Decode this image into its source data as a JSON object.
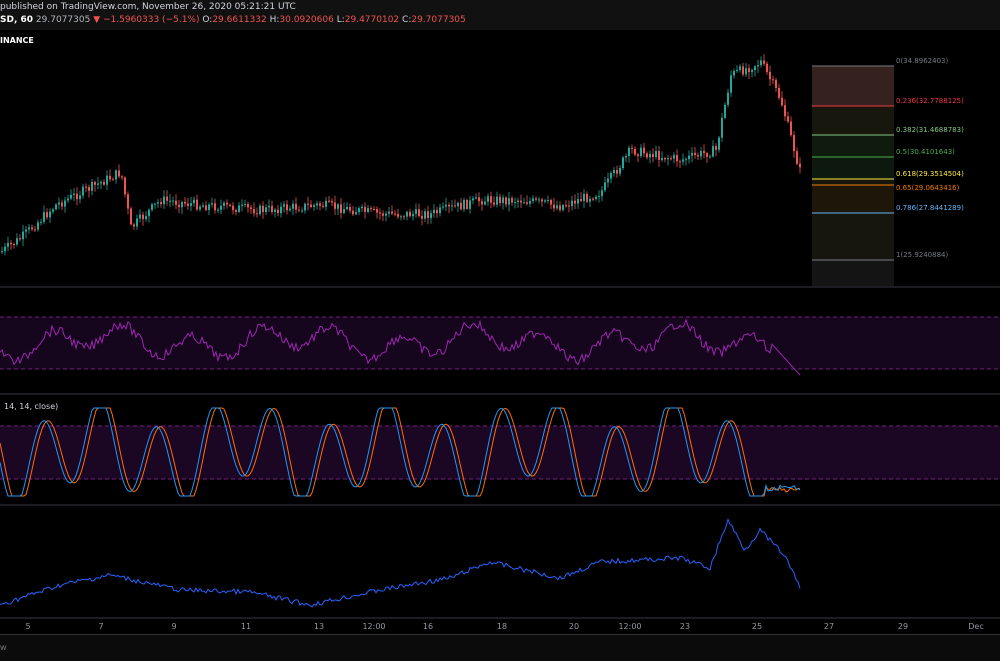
{
  "header": {
    "publish_line": "published on TradingView.com, November 26, 2020 05:21:21 UTC",
    "symbol": "SD, 60",
    "last_price": "29.7077305",
    "arrow": "▼",
    "change": "−1.5960333 (−5.1%)",
    "o_label": "O:",
    "o_value": "29.6611332",
    "h_label": "H:",
    "h_value": "30.0920606",
    "l_label": "L:",
    "l_value": "29.4770102",
    "c_label": "C:",
    "c_value": "29.7077305"
  },
  "exchange_label": "INANCE",
  "stoch_label": "14, 14, close)",
  "fib_levels": [
    {
      "ratio": "0",
      "price": "34.8962403",
      "color": "#787b86"
    },
    {
      "ratio": "0.236",
      "price": "32.7788125",
      "color": "#f23645"
    },
    {
      "ratio": "0.382",
      "price": "31.4688783",
      "color": "#81c784"
    },
    {
      "ratio": "0.5",
      "price": "30.4101643",
      "color": "#4caf50"
    },
    {
      "ratio": "0.618",
      "price": "29.3514504",
      "color": "#ffeb3b"
    },
    {
      "ratio": "0.65",
      "price": "29.0643416",
      "color": "#f57c00"
    },
    {
      "ratio": "0.786",
      "price": "27.8441289",
      "color": "#64b5f6"
    },
    {
      "ratio": "1",
      "price": "25.9240884",
      "color": "#787b86"
    }
  ],
  "x_axis": [
    "5",
    "7",
    "9",
    "11",
    "13",
    "12:00",
    "16",
    "18",
    "20",
    "12:00",
    "23",
    "25",
    "27",
    "29",
    "Dec"
  ],
  "footer_text": "w",
  "colors": {
    "up": "#26a69a",
    "down": "#ef5350",
    "rsi": "#9c27b0",
    "stoch_k": "#2196f3",
    "stoch_d": "#ff6d00",
    "obv": "#2962ff"
  }
}
